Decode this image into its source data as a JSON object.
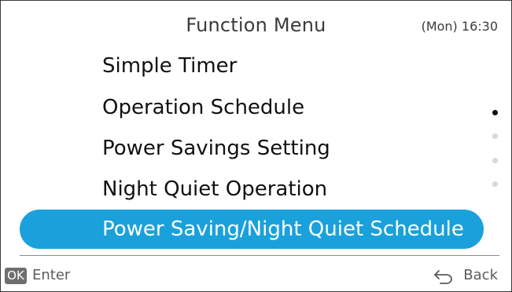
{
  "header": {
    "title": "Function Menu",
    "clock": "(Mon) 16:30"
  },
  "menu": {
    "items": [
      {
        "label": "Simple Timer",
        "selected": false
      },
      {
        "label": "Operation Schedule",
        "selected": false
      },
      {
        "label": "Power Savings Setting",
        "selected": false
      },
      {
        "label": "Night Quiet Operation",
        "selected": false
      },
      {
        "label": "Power Saving/Night Quiet Schedule",
        "selected": true
      }
    ]
  },
  "page_indicator": {
    "total_pages": 4,
    "current_page": 1
  },
  "footer": {
    "ok_badge": "OK",
    "enter_label": "Enter",
    "back_label": "Back",
    "back_icon": "back-arrow-icon"
  },
  "colors": {
    "selection": "#1aa1dc",
    "ok_badge_bg": "#6f6f6f",
    "active_dot": "#111111",
    "inactive_dot": "#d8d8d8"
  }
}
